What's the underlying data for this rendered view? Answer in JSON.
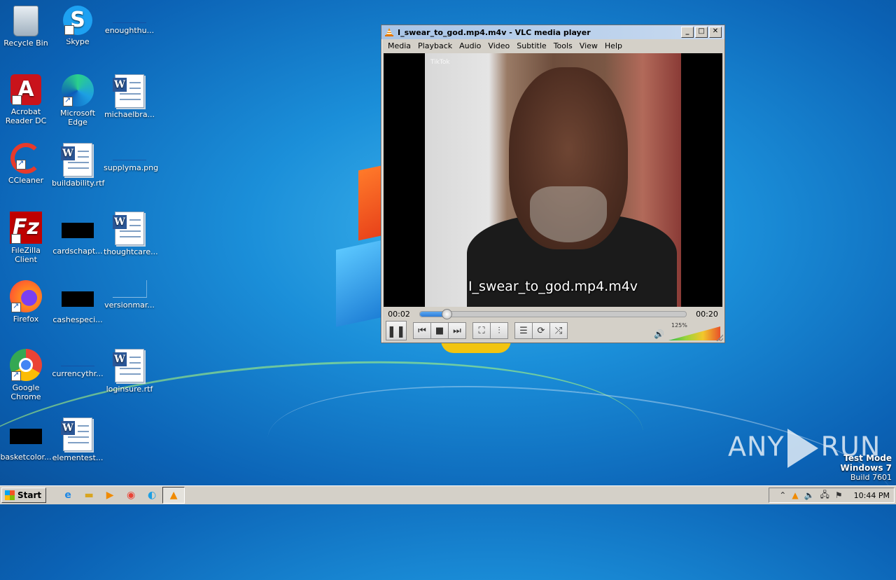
{
  "desktop": {
    "icons": [
      {
        "label": "Recycle Bin"
      },
      {
        "label": "Skype"
      },
      {
        "label": "enoughthu..."
      },
      {
        "label": "Acrobat Reader DC"
      },
      {
        "label": "Microsoft Edge"
      },
      {
        "label": "michaelbra..."
      },
      {
        "label": "CCleaner"
      },
      {
        "label": "buildability.rtf"
      },
      {
        "label": "supplyma.png"
      },
      {
        "label": "FileZilla Client"
      },
      {
        "label": "cardschapt..."
      },
      {
        "label": "thoughtcare..."
      },
      {
        "label": "Firefox"
      },
      {
        "label": "cashespeci..."
      },
      {
        "label": "versionmar..."
      },
      {
        "label": "Google Chrome"
      },
      {
        "label": "currencythr..."
      },
      {
        "label": "loginsure.rtf"
      },
      {
        "label": "basketcolor..."
      },
      {
        "label": "elementest..."
      }
    ]
  },
  "vlc": {
    "title": "I_swear_to_god.mp4.m4v - VLC media player",
    "menu": [
      "Media",
      "Playback",
      "Audio",
      "Video",
      "Subtitle",
      "Tools",
      "View",
      "Help"
    ],
    "subtitle": "I_swear_to_god.mp4.m4v",
    "overlay_text": "TikTok",
    "elapsed": "00:02",
    "duration": "00:20",
    "progress_fraction": 0.1,
    "volume_label": "125%",
    "volume_percent": 125,
    "window_buttons": {
      "minimize": "_",
      "maximize": "□",
      "close": "✕"
    }
  },
  "watermark": {
    "left": "ANY",
    "right": "RUN"
  },
  "system": {
    "mode": "Test Mode",
    "os": "Windows 7",
    "build": "Build 7601"
  },
  "taskbar": {
    "start_label": "Start",
    "clock": "10:44 PM"
  }
}
